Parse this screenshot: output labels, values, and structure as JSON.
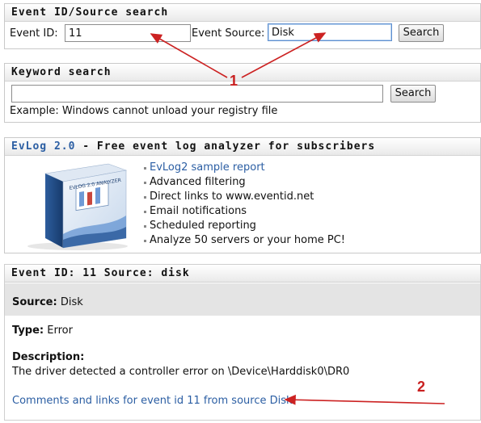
{
  "event_search": {
    "title": "Event ID/Source search",
    "event_id_label": "Event ID:",
    "event_id_value": "11",
    "event_source_label": "Event Source:",
    "event_source_value": "Disk",
    "search_label": "Search"
  },
  "keyword_search": {
    "title": "Keyword search",
    "keyword_value": "",
    "search_label": "Search",
    "example": "Example: Windows cannot unload your registry file"
  },
  "evlog": {
    "title_link": "EvLog 2.0",
    "title_rest": " - Free event log analyzer for subscribers",
    "box_text": "EVLOG 2.0 ANALYZER",
    "features": [
      "EvLog2 sample report",
      "Advanced filtering",
      "Direct links to www.eventid.net",
      "Email notifications",
      "Scheduled reporting",
      "Analyze 50 servers or your home PC!"
    ]
  },
  "event_detail": {
    "title": "Event ID: 11 Source: disk",
    "source_label": "Source:",
    "source_value": " Disk",
    "type_label": "Type:",
    "type_value": " Error",
    "description_label": "Description:",
    "description_text": "The driver detected a controller error on \\Device\\Harddisk0\\DR0",
    "comments_link": "Comments and links for event id 11 from source Disk"
  },
  "annotations": {
    "callout_1": "1",
    "callout_2": "2",
    "arrow_color": "#cc2222"
  }
}
